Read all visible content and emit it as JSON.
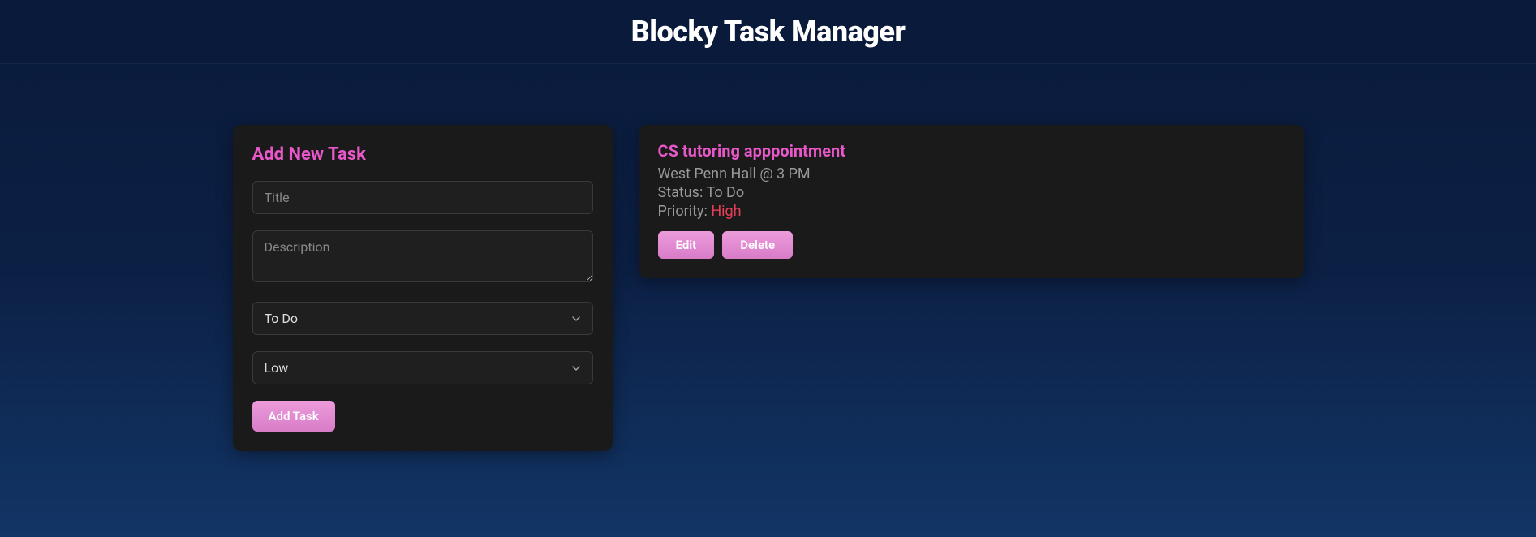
{
  "header": {
    "title": "Blocky Task Manager"
  },
  "form": {
    "heading": "Add New Task",
    "title_placeholder": "Title",
    "description_placeholder": "Description",
    "status_selected": "To Do",
    "priority_selected": "Low",
    "submit_label": "Add Task"
  },
  "tasks": [
    {
      "title": "CS tutoring apppointment",
      "description": "West Penn Hall @ 3 PM",
      "status_label": "Status: ",
      "status_value": "To Do",
      "priority_label": "Priority: ",
      "priority_value": "High",
      "edit_label": "Edit",
      "delete_label": "Delete"
    }
  ]
}
